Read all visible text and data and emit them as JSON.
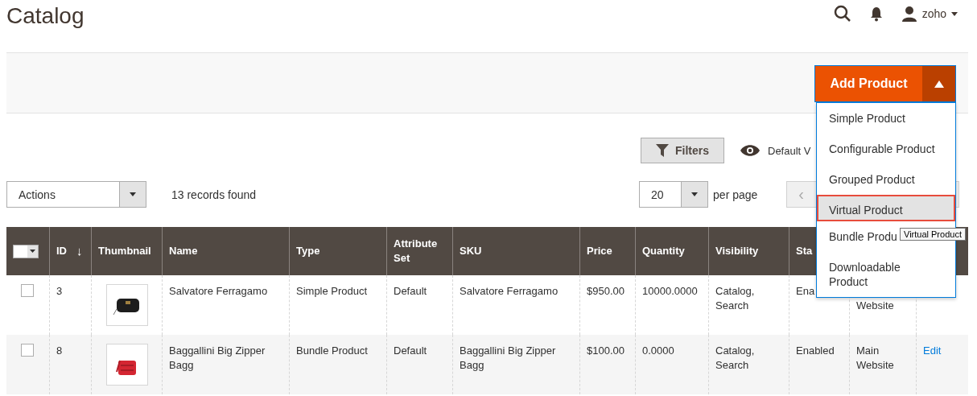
{
  "page_title": "Catalog",
  "header": {
    "user": "zoho"
  },
  "add_button": {
    "label": "Add Product",
    "expanded": true
  },
  "add_menu": [
    {
      "label": "Simple Product",
      "selected": false
    },
    {
      "label": "Configurable Product",
      "selected": false
    },
    {
      "label": "Grouped Product",
      "selected": false
    },
    {
      "label": "Virtual Product",
      "selected": true
    },
    {
      "label": "Bundle Produ",
      "selected": false
    },
    {
      "label": "Downloadable Product",
      "selected": false
    }
  ],
  "tooltip": "Virtual Product",
  "filters_button": "Filters",
  "view_label": "Default V",
  "actions_select": "Actions",
  "records": "13 records found",
  "per_page": {
    "value": "20",
    "label": "per page"
  },
  "pager": {
    "prev": "‹"
  },
  "table": {
    "columns": [
      {
        "label": "ID",
        "sort": "↓"
      },
      {
        "label": "Thumbnail"
      },
      {
        "label": "Name"
      },
      {
        "label": "Type"
      },
      {
        "label": "Attribute Set"
      },
      {
        "label": "SKU"
      },
      {
        "label": "Price"
      },
      {
        "label": "Quantity"
      },
      {
        "label": "Visibility"
      },
      {
        "label": "Sta"
      }
    ],
    "rows": [
      {
        "checked": false,
        "id": "3",
        "name": "Salvatore Ferragamo",
        "type": "Simple Product",
        "attribute_set": "Default",
        "sku": "Salvatore Ferragamo",
        "price": "$950.00",
        "quantity": "10000.0000",
        "visibility": "Catalog, Search",
        "status": "Ena",
        "websites": "Website"
      },
      {
        "checked": false,
        "id": "8",
        "name": "Baggallini Big Zipper Bagg",
        "type": "Bundle Product",
        "attribute_set": "Default",
        "sku": "Baggallini Big Zipper Bagg",
        "price": "$100.00",
        "quantity": "0.0000",
        "visibility": "Catalog, Search",
        "status": "Enabled",
        "websites": "Main Website",
        "action": "Edit"
      }
    ]
  }
}
